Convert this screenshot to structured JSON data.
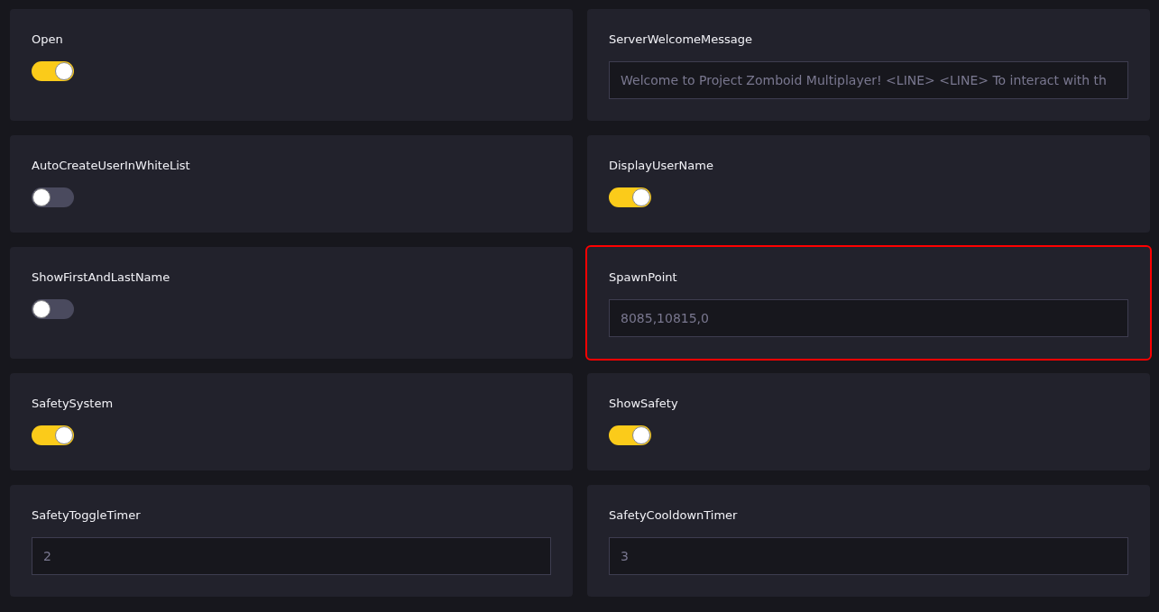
{
  "settings": [
    {
      "kind": "toggle",
      "label": "Open",
      "on": true
    },
    {
      "kind": "text",
      "label": "ServerWelcomeMessage",
      "value": "Welcome to Project Zomboid Multiplayer! <LINE> <LINE> To interact with th"
    },
    {
      "kind": "toggle",
      "label": "AutoCreateUserInWhiteList",
      "on": false
    },
    {
      "kind": "toggle",
      "label": "DisplayUserName",
      "on": true
    },
    {
      "kind": "toggle",
      "label": "ShowFirstAndLastName",
      "on": false
    },
    {
      "kind": "text",
      "label": "SpawnPoint",
      "value": "8085,10815,0",
      "highlighted": true
    },
    {
      "kind": "toggle",
      "label": "SafetySystem",
      "on": true
    },
    {
      "kind": "toggle",
      "label": "ShowSafety",
      "on": true
    },
    {
      "kind": "text",
      "label": "SafetyToggleTimer",
      "value": "2"
    },
    {
      "kind": "text",
      "label": "SafetyCooldownTimer",
      "value": "3"
    }
  ]
}
